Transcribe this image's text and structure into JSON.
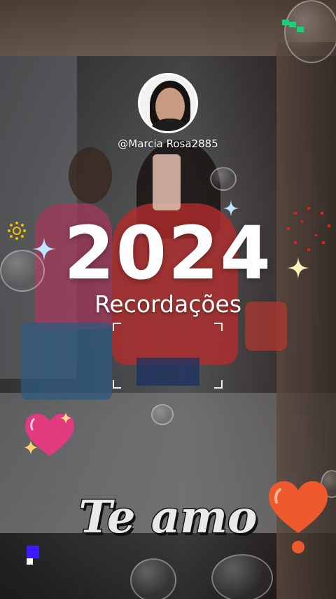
{
  "profile": {
    "username": "@Marcia Rosa2885",
    "avatar_alt": "avatar"
  },
  "title": {
    "year": "2024",
    "subtitle": "Recordações"
  },
  "caption": {
    "text": "Te amo"
  },
  "colors": {
    "text": "#ffffff",
    "caption_fill": "#e9e9e9",
    "caption_stroke": "#111111",
    "heart_pink": "#e23a7f",
    "heart_orange": "#ee5a2e",
    "pixel_green": "#18d27a",
    "pixel_blue": "#3a1bff",
    "sun_yellow": "#f2c100",
    "dots_red": "#e0221d",
    "sparkle": "#bfe6ff"
  },
  "icons": {
    "sparkle": "sparkle-icon",
    "heart": "heart-icon",
    "sun": "sun-icon",
    "pixels": "pixel-cluster-icon",
    "dots": "dot-ring-icon"
  }
}
